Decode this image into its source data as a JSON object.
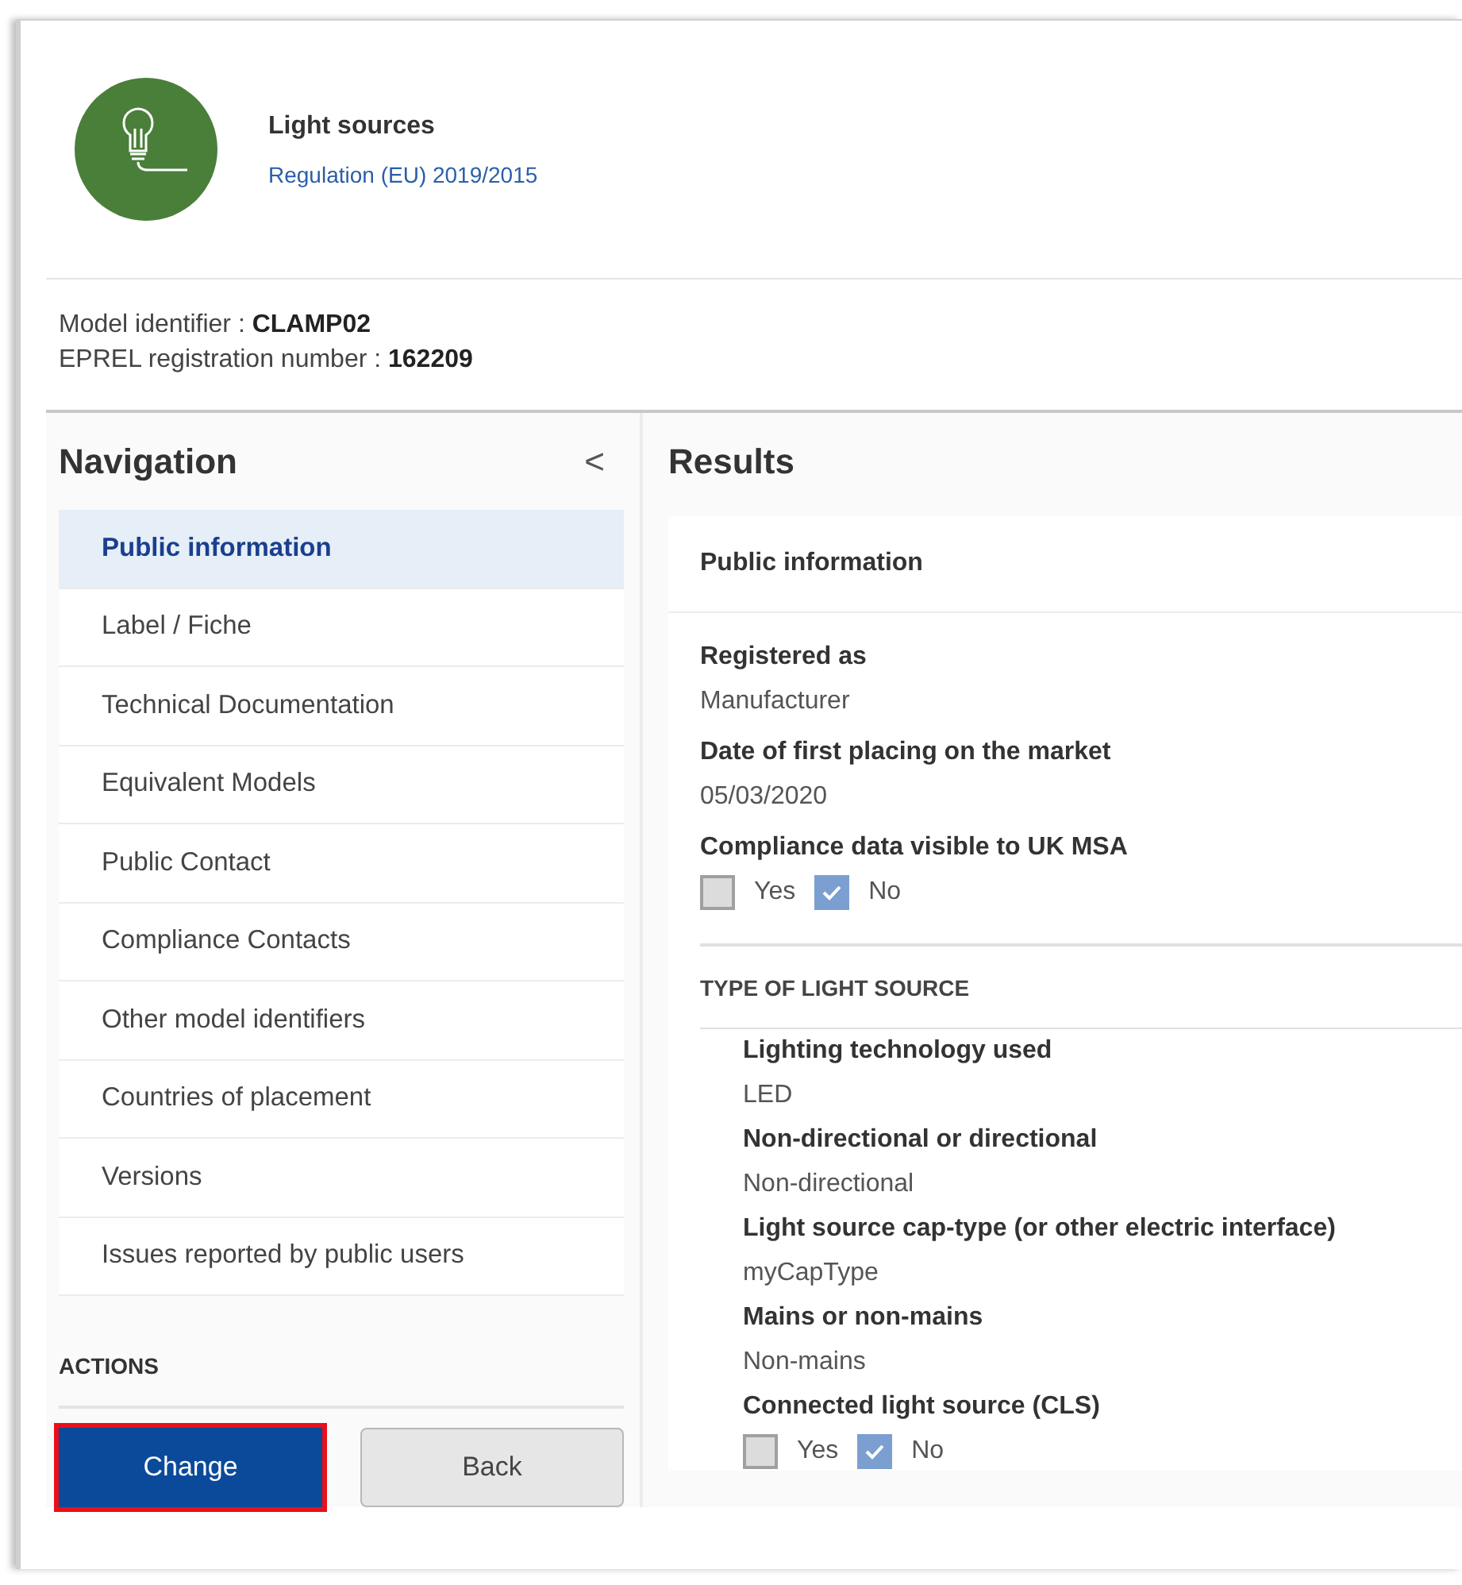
{
  "header": {
    "title": "Light sources",
    "regulation_link": "Regulation (EU) 2019/2015"
  },
  "identifiers": [
    {
      "label": "Model identifier : ",
      "value": "CLAMP02"
    },
    {
      "label": "EPREL registration number : ",
      "value": "162209"
    }
  ],
  "navigation": {
    "title": "Navigation",
    "collapse_icon": "<",
    "items": [
      {
        "label": "Public information",
        "selected": true
      },
      {
        "label": "Label / Fiche",
        "selected": false
      },
      {
        "label": "Technical Documentation",
        "selected": false
      },
      {
        "label": "Equivalent Models",
        "selected": false
      },
      {
        "label": "Public Contact",
        "selected": false
      },
      {
        "label": "Compliance Contacts",
        "selected": false
      },
      {
        "label": "Other model identifiers",
        "selected": false
      },
      {
        "label": "Countries of placement",
        "selected": false
      },
      {
        "label": "Versions",
        "selected": false
      },
      {
        "label": "Issues reported by public users",
        "selected": false
      }
    ],
    "actions_title": "ACTIONS",
    "buttons": [
      {
        "label": "Change",
        "kind": "primary",
        "highlighted": true
      },
      {
        "label": "Back",
        "kind": "secondary",
        "highlighted": false
      }
    ]
  },
  "results": {
    "title": "Results",
    "card_title": "Public information",
    "fields": [
      {
        "kind": "text",
        "label": "Registered as",
        "value": "Manufacturer"
      },
      {
        "kind": "text",
        "label": "Date of first placing on the market",
        "value": "05/03/2020"
      },
      {
        "kind": "checkboxes",
        "label": "Compliance data visible to UK MSA",
        "options": [
          {
            "label": "Yes",
            "checked": false
          },
          {
            "label": "No",
            "checked": true
          }
        ]
      }
    ],
    "section_title": "TYPE OF LIGHT SOURCE",
    "section_fields": [
      {
        "kind": "text",
        "label": "Lighting technology used",
        "value": "LED"
      },
      {
        "kind": "text",
        "label": "Non-directional or directional",
        "value": "Non-directional"
      },
      {
        "kind": "text",
        "label": "Light source cap-type (or other electric interface)",
        "value": "myCapType"
      },
      {
        "kind": "text",
        "label": "Mains or non-mains",
        "value": "Non-mains"
      },
      {
        "kind": "checkboxes",
        "label": "Connected light source (CLS)",
        "options": [
          {
            "label": "Yes",
            "checked": false
          },
          {
            "label": "No",
            "checked": true
          }
        ]
      }
    ]
  }
}
